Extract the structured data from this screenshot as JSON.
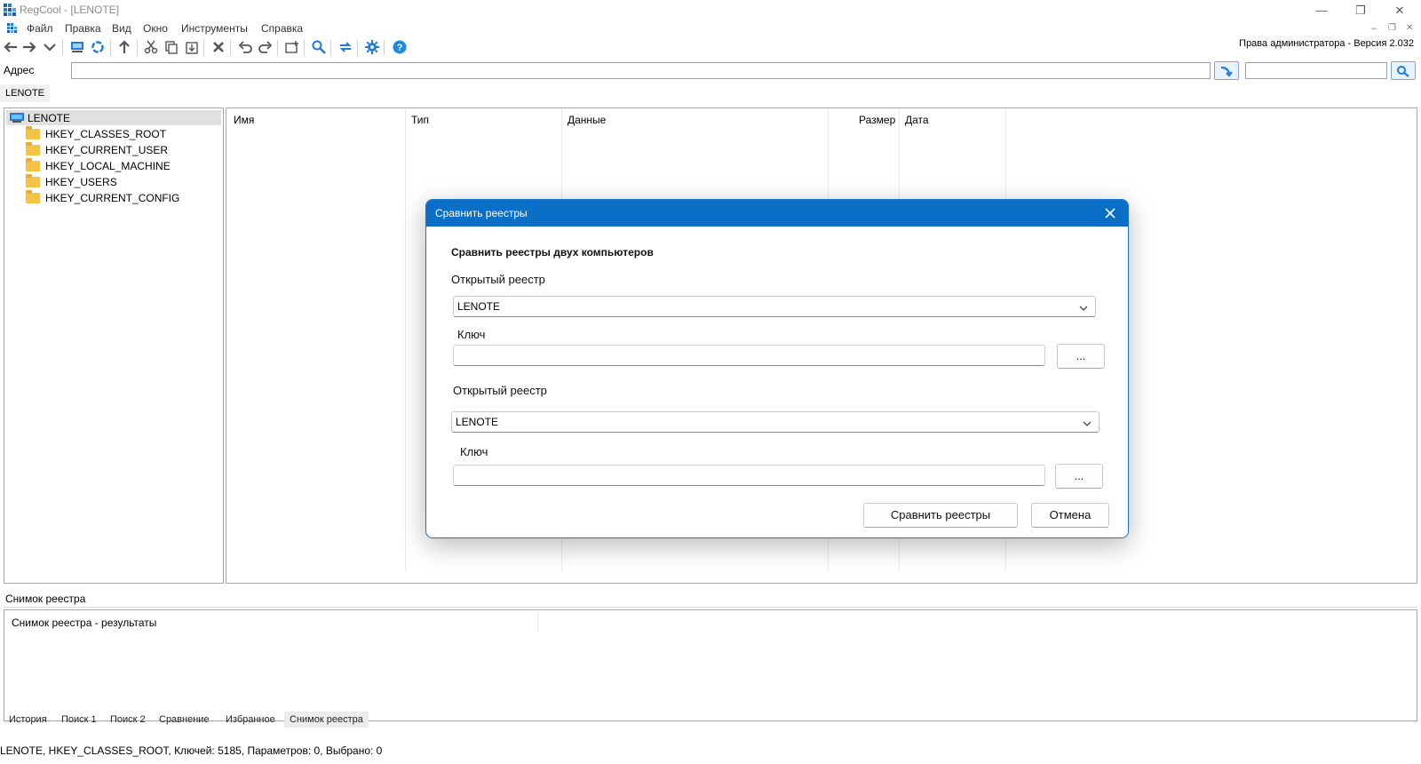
{
  "window": {
    "title": "RegCool - [LENOTE]",
    "min": "—",
    "restore": "❐",
    "close": "✕"
  },
  "menu": [
    "Файл",
    "Правка",
    "Вид",
    "Окно",
    "Инструменты",
    "Справка"
  ],
  "mdi_controls": [
    "–",
    "❐",
    "✕"
  ],
  "toolbar": {
    "admin_label": "Права администратора - Версия 2.032",
    "icons": [
      "back-arrow-icon",
      "forward-arrow-icon",
      "dropdown-icon",
      "computer-icon",
      "refresh-icon",
      "up-arrow-icon",
      "cut-icon",
      "copy-icon",
      "paste-icon",
      "delete-icon",
      "undo-icon",
      "redo-icon",
      "new-key-icon",
      "search-icon",
      "compare-icon",
      "settings-icon",
      "help-icon"
    ]
  },
  "address": {
    "label": "Адрес",
    "value": "",
    "search_value": "",
    "breadcrumb": "LENOTE"
  },
  "tree": {
    "root": "LENOTE",
    "items": [
      "HKEY_CLASSES_ROOT",
      "HKEY_CURRENT_USER",
      "HKEY_LOCAL_MACHINE",
      "HKEY_USERS",
      "HKEY_CURRENT_CONFIG"
    ]
  },
  "list": {
    "columns": [
      "Имя",
      "Тип",
      "Данные",
      "Размер",
      "Дата"
    ]
  },
  "snapshot": {
    "header": "Снимок реестра",
    "results_label": "Снимок реестра - результаты"
  },
  "tabs": [
    "История",
    "Поиск 1",
    "Поиск 2",
    "Сравнение",
    "Избранное",
    "Снимок реестра"
  ],
  "active_tab": "Снимок реестра",
  "status": "LENOTE, HKEY_CLASSES_ROOT, Ключей: 5185, Параметров: 0, Выбрано: 0",
  "dialog": {
    "title": "Сравнить реестры",
    "heading": "Сравнить реестры двух компьютеров",
    "reg1_label": "Открытый реестр",
    "reg1_value": "LENOTE",
    "key1_label": "Ключ",
    "key1_value": "",
    "browse1": "...",
    "reg2_label": "Открытый реестр",
    "reg2_value": "LENOTE",
    "key2_label": "Ключ",
    "key2_value": "",
    "browse2": "...",
    "compare_button": "Сравнить реестры",
    "cancel_button": "Отмена"
  },
  "colors": {
    "accent": "#0b6fc7",
    "folder": "#f6c243",
    "toolbar_blue": "#1e7bd6"
  }
}
